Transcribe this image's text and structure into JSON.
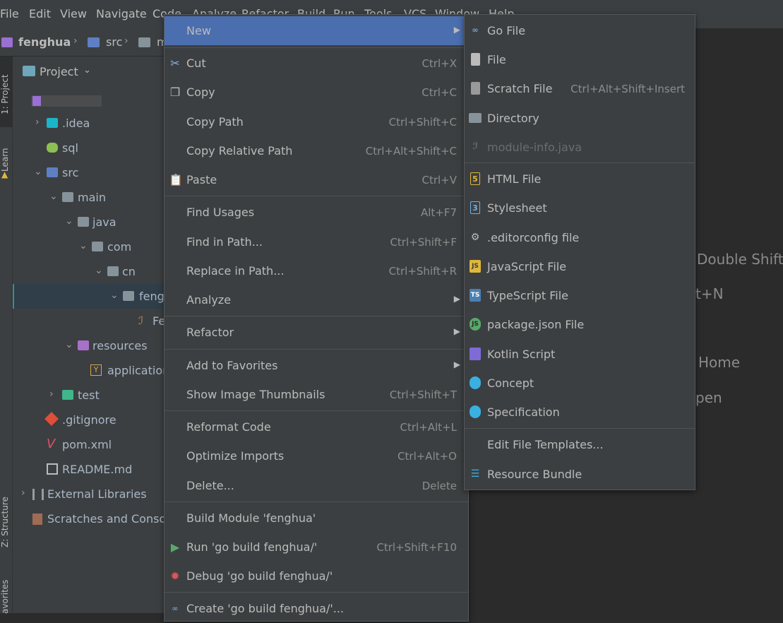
{
  "menubar": {
    "items": [
      "File",
      "Edit",
      "View",
      "Navigate",
      "Code",
      "Analyze",
      "Refactor",
      "Build",
      "Run",
      "Tools",
      "VCS",
      "Window",
      "Help"
    ]
  },
  "navbar": {
    "project": "fenghua",
    "crumb1": "src",
    "crumb2": "m"
  },
  "sidebar": {
    "project_tab": "1: Project",
    "learn_tab": "Learn",
    "structure_tab": "Z: Structure",
    "favorites_tab": "avorites"
  },
  "project_panel": {
    "title": "Project",
    "tree": [
      {
        "label": ".idea"
      },
      {
        "label": "sql"
      },
      {
        "label": "src"
      },
      {
        "label": "main"
      },
      {
        "label": "java"
      },
      {
        "label": "com"
      },
      {
        "label": "cn"
      },
      {
        "label": "fengh"
      },
      {
        "label": "Fe"
      },
      {
        "label": "resources"
      },
      {
        "label": "application"
      },
      {
        "label": "test"
      },
      {
        "label": ".gitignore"
      },
      {
        "label": "pom.xml"
      },
      {
        "label": "README.md"
      },
      {
        "label": "External Libraries"
      },
      {
        "label": "Scratches and Consoles"
      }
    ]
  },
  "editor_hints": {
    "h1": "Double Shift",
    "h2": "t+N",
    "h3": "Home",
    "h4": "pen"
  },
  "context_menu": {
    "new": "New",
    "cut": "Cut",
    "cut_sc": "Ctrl+X",
    "copy": "Copy",
    "copy_sc": "Ctrl+C",
    "copy_path": "Copy Path",
    "copy_path_sc": "Ctrl+Shift+C",
    "copy_rel": "Copy Relative Path",
    "copy_rel_sc": "Ctrl+Alt+Shift+C",
    "paste": "Paste",
    "paste_sc": "Ctrl+V",
    "find_usages": "Find Usages",
    "find_usages_sc": "Alt+F7",
    "find_in_path": "Find in Path...",
    "find_in_path_sc": "Ctrl+Shift+F",
    "replace_in_path": "Replace in Path...",
    "replace_in_path_sc": "Ctrl+Shift+R",
    "analyze": "Analyze",
    "refactor": "Refactor",
    "add_fav": "Add to Favorites",
    "show_thumbs": "Show Image Thumbnails",
    "show_thumbs_sc": "Ctrl+Shift+T",
    "reformat": "Reformat Code",
    "reformat_sc": "Ctrl+Alt+L",
    "optimize": "Optimize Imports",
    "optimize_sc": "Ctrl+Alt+O",
    "delete": "Delete...",
    "delete_sc": "Delete",
    "build_module": "Build Module 'fenghua'",
    "run": "Run 'go build fenghua/'",
    "run_sc": "Ctrl+Shift+F10",
    "debug": "Debug 'go build fenghua/'",
    "create": "Create 'go build fenghua/'..."
  },
  "new_submenu": {
    "go_file": "Go File",
    "file": "File",
    "scratch": "Scratch File",
    "scratch_sc": "Ctrl+Alt+Shift+Insert",
    "directory": "Directory",
    "module_info": "module-info.java",
    "html": "HTML File",
    "stylesheet": "Stylesheet",
    "editorconfig": ".editorconfig file",
    "js": "JavaScript File",
    "ts": "TypeScript File",
    "pkg_json": "package.json File",
    "kotlin": "Kotlin Script",
    "concept": "Concept",
    "spec": "Specification",
    "edit_templates": "Edit File Templates...",
    "resource_bundle": "Resource Bundle"
  },
  "colors": {
    "bg": "#3c3f41",
    "editor_bg": "#2b2b2b",
    "selection": "#4b6eaf",
    "tree_selection": "#2f3e48"
  }
}
